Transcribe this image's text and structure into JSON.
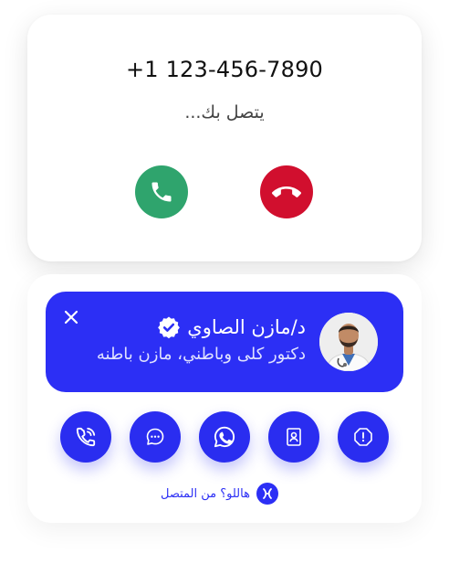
{
  "incoming_call": {
    "phone_number": "+1 123-456-7890",
    "status_text": "يتصل بك...",
    "accept_icon": "phone-icon",
    "decline_icon": "phone-hangup-icon"
  },
  "caller_banner": {
    "name": "د/مازن الصاوي",
    "subtitle": "دكتور كلى وباطني، مازن باطنه",
    "verified_icon": "verified-badge-icon",
    "close_icon": "close-icon"
  },
  "actions": [
    {
      "name": "call",
      "icon": "phone-call-icon"
    },
    {
      "name": "message",
      "icon": "chat-bubble-icon"
    },
    {
      "name": "whatsapp",
      "icon": "whatsapp-icon"
    },
    {
      "name": "contact",
      "icon": "contact-card-icon"
    },
    {
      "name": "report",
      "icon": "alert-octagon-icon"
    }
  ],
  "footer": {
    "text": "هاللو؟ من المتصل",
    "logo_icon": "hallo-logo-icon"
  },
  "colors": {
    "accent": "#2c2ff5",
    "accept": "#2fa46d",
    "decline": "#d10f2e"
  }
}
